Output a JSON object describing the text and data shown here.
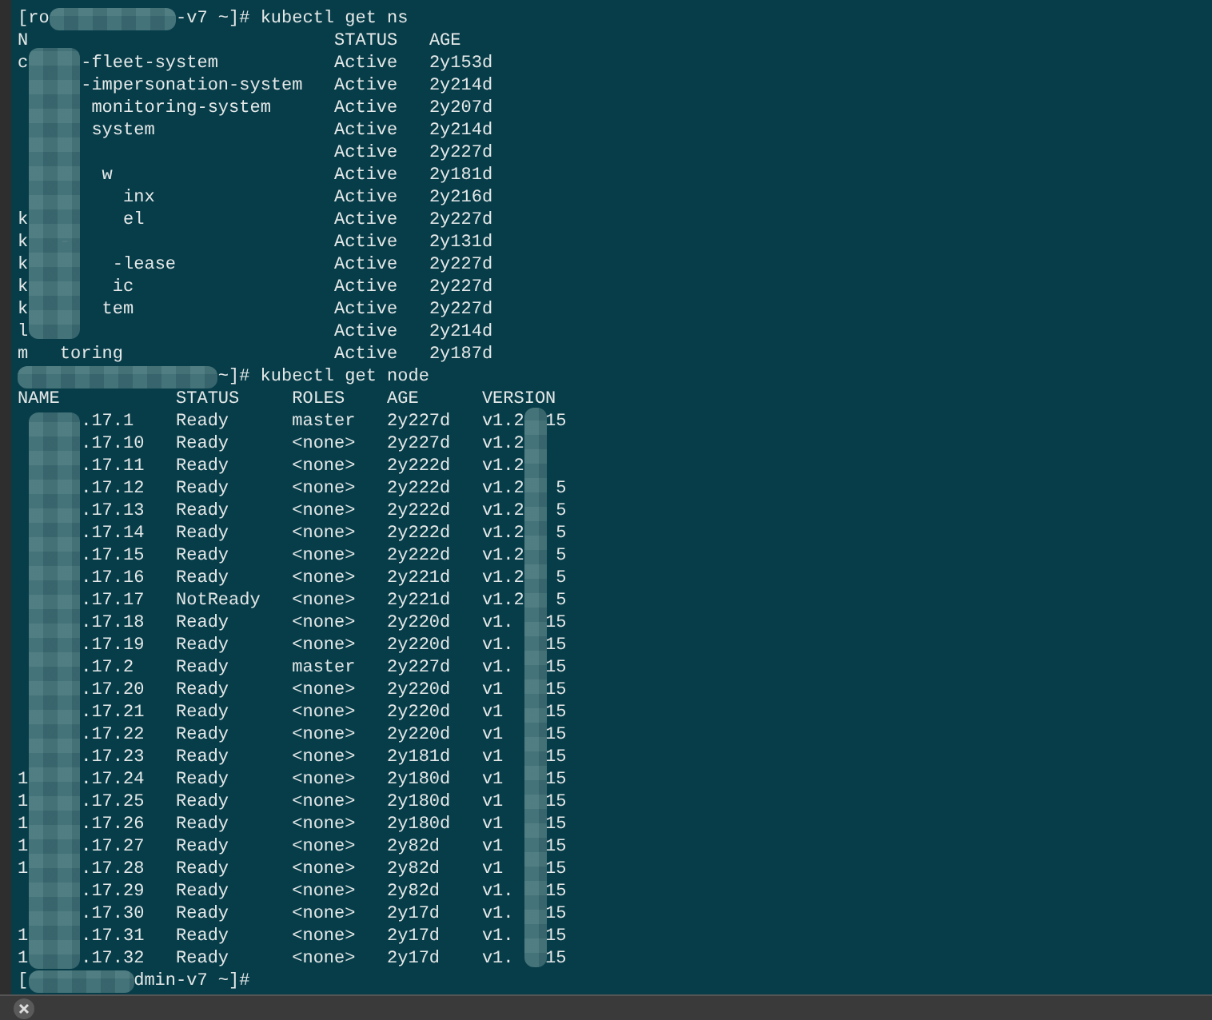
{
  "terminal": {
    "blocks": [
      {
        "prompt": "[ro            -v7 ~]# kubectl get ns",
        "table": {
          "columns": [
            "N",
            "STATUS",
            "AGE"
          ],
          "rows": [
            [
              "c     -fleet-system",
              "Active",
              "2y153d"
            ],
            [
              "      -impersonation-system",
              "Active",
              "2y214d"
            ],
            [
              "       monitoring-system",
              "Active",
              "2y207d"
            ],
            [
              "       system",
              "Active",
              "2y214d"
            ],
            [
              "",
              "Active",
              "2y227d"
            ],
            [
              "        w",
              "Active",
              "2y181d"
            ],
            [
              "          inx",
              "Active",
              "2y216d"
            ],
            [
              "k         el",
              "Active",
              "2y227d"
            ],
            [
              "k   -",
              "Active",
              "2y131d"
            ],
            [
              "k        -lease",
              "Active",
              "2y227d"
            ],
            [
              "k        ic",
              "Active",
              "2y227d"
            ],
            [
              "k       tem",
              "Active",
              "2y227d"
            ],
            [
              "l",
              "Active",
              "2y214d"
            ],
            [
              "m   toring",
              "Active",
              "2y187d"
            ]
          ]
        }
      },
      {
        "prompt": "                   ~]# kubectl get node",
        "table": {
          "columns": [
            "NAME",
            "STATUS",
            "ROLES",
            "AGE",
            "VERSION"
          ],
          "rows": [
            [
              "      .17.1",
              "Ready",
              "master",
              "2y227d",
              "v1.2  15"
            ],
            [
              "      .17.10",
              "Ready",
              "<none>",
              "2y227d",
              "v1.2"
            ],
            [
              "      .17.11",
              "Ready",
              "<none>",
              "2y222d",
              "v1.2"
            ],
            [
              "      .17.12",
              "Ready",
              "<none>",
              "2y222d",
              "v1.2   5"
            ],
            [
              "      .17.13",
              "Ready",
              "<none>",
              "2y222d",
              "v1.2   5"
            ],
            [
              "      .17.14",
              "Ready",
              "<none>",
              "2y222d",
              "v1.2   5"
            ],
            [
              "      .17.15",
              "Ready",
              "<none>",
              "2y222d",
              "v1.2   5"
            ],
            [
              "      .17.16",
              "Ready",
              "<none>",
              "2y221d",
              "v1.2   5"
            ],
            [
              "      .17.17",
              "NotReady",
              "<none>",
              "2y221d",
              "v1.2   5"
            ],
            [
              "      .17.18",
              "Ready",
              "<none>",
              "2y220d",
              "v1.   15"
            ],
            [
              "      .17.19",
              "Ready",
              "<none>",
              "2y220d",
              "v1.   15"
            ],
            [
              "      .17.2",
              "Ready",
              "master",
              "2y227d",
              "v1.   15"
            ],
            [
              "      .17.20",
              "Ready",
              "<none>",
              "2y220d",
              "v1    15"
            ],
            [
              "      .17.21",
              "Ready",
              "<none>",
              "2y220d",
              "v1    15"
            ],
            [
              "      .17.22",
              "Ready",
              "<none>",
              "2y220d",
              "v1    15"
            ],
            [
              "      .17.23",
              "Ready",
              "<none>",
              "2y181d",
              "v1    15"
            ],
            [
              "1     .17.24",
              "Ready",
              "<none>",
              "2y180d",
              "v1    15"
            ],
            [
              "1     .17.25",
              "Ready",
              "<none>",
              "2y180d",
              "v1    15"
            ],
            [
              "1     .17.26",
              "Ready",
              "<none>",
              "2y180d",
              "v1    15"
            ],
            [
              "1     .17.27",
              "Ready",
              "<none>",
              "2y82d",
              "v1    15"
            ],
            [
              "1     .17.28",
              "Ready",
              "<none>",
              "2y82d",
              "v1    15"
            ],
            [
              "      .17.29",
              "Ready",
              "<none>",
              "2y82d",
              "v1.   15"
            ],
            [
              "      .17.30",
              "Ready",
              "<none>",
              "2y17d",
              "v1.   15"
            ],
            [
              "1     .17.31",
              "Ready",
              "<none>",
              "2y17d",
              "v1.   15"
            ],
            [
              "1     .17.32",
              "Ready",
              "<none>",
              "2y17d",
              "v1.   15"
            ]
          ]
        }
      },
      {
        "prompt": "[          dmin-v7 ~]#"
      }
    ]
  }
}
